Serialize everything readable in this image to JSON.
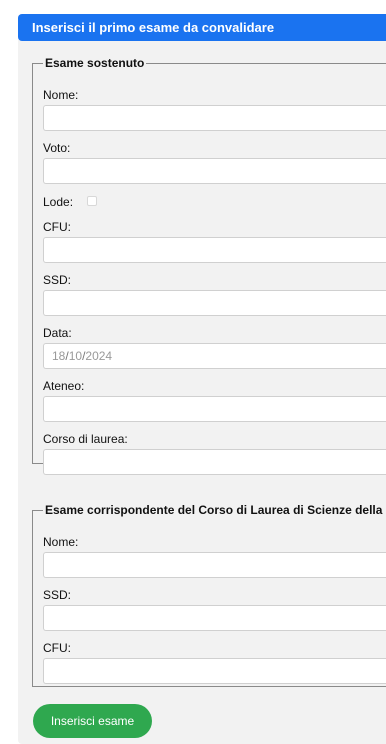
{
  "header": {
    "title": "Inserisci il primo esame da convalidare"
  },
  "section1": {
    "legend": "Esame sostenuto",
    "nome_label": "Nome:",
    "voto_label": "Voto:",
    "lode_label": "Lode:",
    "cfu_label": "CFU:",
    "ssd_label": "SSD:",
    "data_label": "Data:",
    "data_day": "18",
    "data_month": "10",
    "data_year": "2024",
    "data_sep": "/",
    "ateneo_label": "Ateneo:",
    "corso_label": "Corso di laurea:"
  },
  "section2": {
    "legend": "Esame corrispondente del Corso di Laurea di Scienze della Fo",
    "nome_label": "Nome:",
    "ssd_label": "SSD:",
    "cfu_label": "CFU:"
  },
  "submit": {
    "label": "Inserisci esame"
  },
  "colors": {
    "header_bg": "#1a73f0",
    "panel_bg": "#f2f2f2",
    "submit_bg": "#2fa84f"
  }
}
